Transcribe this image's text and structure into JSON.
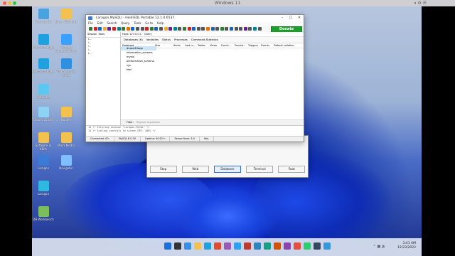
{
  "host": {
    "title": "Windows 11"
  },
  "desktop_icons": [
    {
      "label": "Recycle Bin",
      "icon": "recycle-bin-icon"
    },
    {
      "label": "Jaws - Shortcut",
      "icon": "folder-icon"
    },
    {
      "label": "Microsoft Edge",
      "icon": "edge-icon"
    },
    {
      "label": "Parallels Shared Folders",
      "icon": "shared-folder-icon"
    },
    {
      "label": "Microsoft Edge",
      "icon": "edge-icon"
    },
    {
      "label": "Visual Studio Code",
      "icon": "vscode-icon"
    },
    {
      "label": "Web Sites",
      "icon": "globe-icon"
    },
    {
      "label": "Editors 2024-1",
      "icon": "tool-icon"
    },
    {
      "label": "Bundle",
      "icon": "folder-icon"
    },
    {
      "label": "Software in 4Bits",
      "icon": "folder-icon"
    },
    {
      "label": "Mind_Media",
      "icon": "folder-icon"
    },
    {
      "label": "Laragon",
      "icon": "laragon-icon"
    },
    {
      "label": "Navigator",
      "icon": "navigator-icon"
    },
    {
      "label": "Laragon",
      "icon": "laragon-icon"
    },
    {
      "label": "DB Workbench",
      "icon": "db-icon"
    }
  ],
  "heidisql": {
    "title": "Laragon.MySQL\\ - HeidiSQL Portable 12.1.0.6537",
    "menu": [
      "File",
      "Edit",
      "Search",
      "Query",
      "Tools",
      "Go to",
      "Help"
    ],
    "donate_label": "Donate",
    "left_tabs": [
      "Session",
      "Tools"
    ],
    "tree_items": [
      "L...",
      "i...",
      "l...",
      "l...",
      "t..."
    ],
    "host_label": "Host: 127.0.0.1",
    "query_label": "Query",
    "tabs": [
      "Databases (6)",
      "Variables",
      "Status",
      "Processes",
      "Command-Statistics"
    ],
    "columns": [
      "Database",
      "Size",
      "Items",
      "Last m...",
      "Tables",
      "Views",
      "Functi...",
      "Proced...",
      "Triggers",
      "Events",
      "Default collation"
    ],
    "databases": [
      "drupal10app",
      "information_schema",
      "mysql",
      "performance_schema",
      "sys",
      "test"
    ],
    "filter_label": "Filter:",
    "filter_placeholder": "Regular expression",
    "log_lines": [
      "13  /* Entering session \"Laragon.MySQL\" */",
      "14  /* Scaling controls to screen DPI: 200% */"
    ],
    "status": [
      "Connected: 00:",
      "MySQL 8.0.30",
      "Uptime: 00:01 h",
      "Server time: 3:4",
      "Idle."
    ]
  },
  "laragon": {
    "buttons": [
      "Stop",
      "Web",
      "Database",
      "Terminal",
      "Root"
    ]
  },
  "taskbar": {
    "time": "3:41 AM",
    "date": "12/23/2022"
  }
}
